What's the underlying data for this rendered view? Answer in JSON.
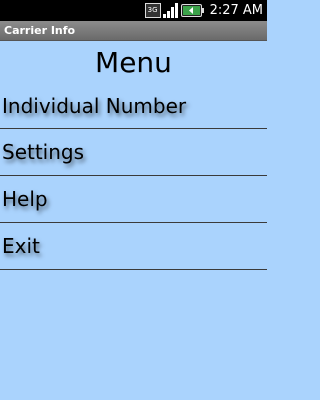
{
  "status_bar": {
    "network_type": "3G",
    "time": "2:27 AM",
    "icons": [
      "3g-icon",
      "signal-icon",
      "battery-icon"
    ]
  },
  "app": {
    "title": "Carrier Info"
  },
  "menu": {
    "heading": "Menu",
    "items": [
      {
        "label": "Individual Number"
      },
      {
        "label": "Settings"
      },
      {
        "label": "Help"
      },
      {
        "label": "Exit"
      }
    ]
  },
  "colors": {
    "background": "#aad3fd",
    "status_bar": "#000000",
    "title_bar": "#7c7c7c",
    "divider": "#3a3a3a",
    "battery_accent": "#3ca34a"
  }
}
